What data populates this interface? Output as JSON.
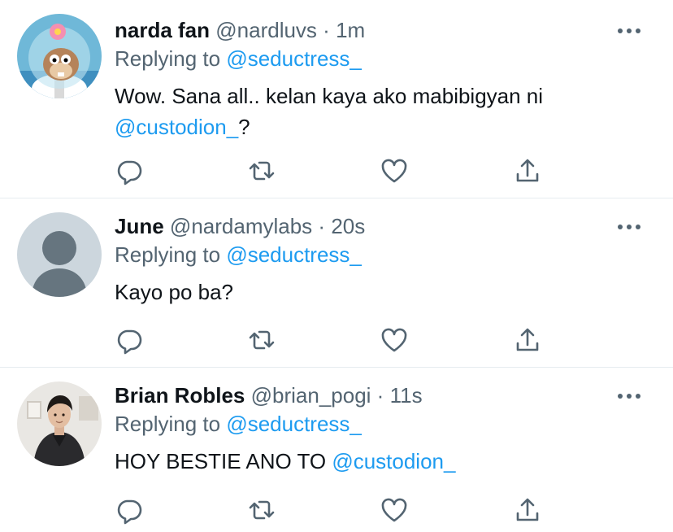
{
  "tweets": [
    {
      "name": "narda fan",
      "handle": "@nardluvs",
      "separator": "·",
      "time": "1m",
      "replying_prefix": "Replying to ",
      "replying_to": "@seductress_",
      "text_before": "Wow. Sana all.. kelan kaya ako mabibigyan ni",
      "text_mention": "@custodion_",
      "text_after": "?",
      "avatar": "spongebob-sandy-avatar"
    },
    {
      "name": "June",
      "handle": "@nardamylabs",
      "separator": "·",
      "time": "20s",
      "replying_prefix": "Replying to ",
      "replying_to": "@seductress_",
      "text_before": "Kayo po ba?",
      "text_mention": "",
      "text_after": "",
      "avatar": "default-user-avatar"
    },
    {
      "name": "Brian Robles",
      "handle": "@brian_pogi",
      "separator": "·",
      "time": "11s",
      "replying_prefix": "Replying to ",
      "replying_to": "@seductress_",
      "text_before": "HOY BESTIE ANO TO ",
      "text_mention": "@custodion_",
      "text_after": "",
      "avatar": "photo-avatar"
    }
  ],
  "icons": [
    "more-options-icon",
    "reply-icon",
    "retweet-icon",
    "like-icon",
    "share-icon"
  ],
  "colors": {
    "link": "#1d9bf0",
    "secondary": "#536471",
    "divider": "#e6ecf0"
  }
}
